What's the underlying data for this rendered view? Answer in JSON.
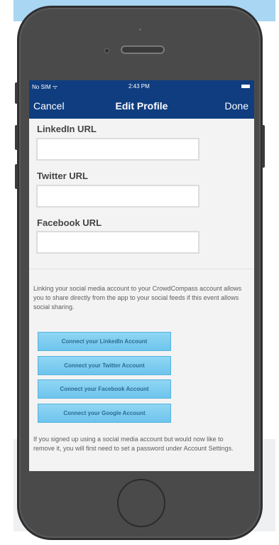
{
  "status_bar": {
    "carrier": "No SIM ᯤ",
    "time": "2:43 PM"
  },
  "nav": {
    "cancel_label": "Cancel",
    "title": "Edit Profile",
    "done_label": "Done"
  },
  "fields": [
    {
      "label": "LinkedIn URL",
      "value": ""
    },
    {
      "label": "Twitter URL",
      "value": ""
    },
    {
      "label": "Facebook URL",
      "value": ""
    }
  ],
  "info_text": "Linking your social media account to your CrowdCompass account allows you to share directly from the app to your social feeds if this event allows social sharing.",
  "connect_buttons": [
    "Connect your LinkedIn Account",
    "Connect your Twitter Account",
    "Connect your Facebook Account",
    "Connect your Google Account"
  ],
  "footer_text": "If you signed up using a social media account but would now like to remove it, you will first need to set a password under Account Settings.",
  "colors": {
    "nav_bar": "#0f3d80",
    "connect_button": "#7fcdf0",
    "phone_body": "#4a4a4b"
  },
  "icons": {
    "wifi": "wifi-icon",
    "battery": "battery-icon"
  }
}
